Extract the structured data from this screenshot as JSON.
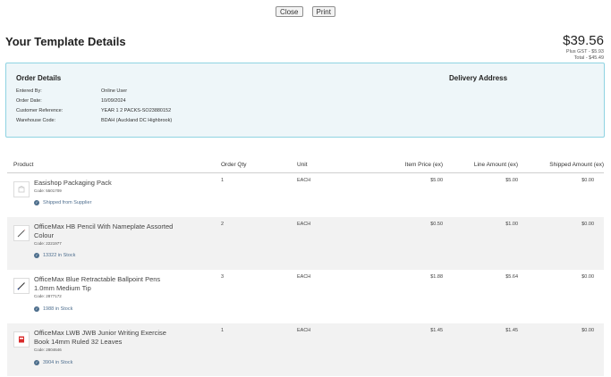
{
  "toolbar": {
    "close_label": "Close",
    "print_label": "Print"
  },
  "page_title": "Your Template Details",
  "totals": {
    "amount": "$39.56",
    "gst": "Plus GST - $5.93",
    "total": "Total - $45.49"
  },
  "order_details": {
    "heading": "Order Details",
    "delivery_heading": "Delivery Address",
    "fields": [
      {
        "label": "Entered By:",
        "value": "Online User"
      },
      {
        "label": "Order Date:",
        "value": "10/09/2024"
      },
      {
        "label": "Customer Reference:",
        "value": "YEAR 1 2 PACKS-SO23880152"
      },
      {
        "label": "Warehouse Code:",
        "value": "BDAH (Auckland DC Highbrook)"
      }
    ]
  },
  "table": {
    "headers": {
      "product": "Product",
      "qty": "Order Qty",
      "unit": "Unit",
      "price": "Item Price (ex)",
      "line": "Line Amount (ex)",
      "shipped": "Shipped Amount (ex)"
    },
    "items": [
      {
        "name": "Easishop Packaging Pack",
        "code": "Code: 5501709",
        "stock": "Shipped from Supplier",
        "qty": "1",
        "unit": "EACH",
        "price": "$5.00",
        "line": "$5.00",
        "shipped": "$0.00",
        "icon": "box-icon"
      },
      {
        "name": "OfficeMax HB Pencil With Nameplate Assorted Colour",
        "code": "Code: 2221977",
        "stock": "13322 in Stock",
        "qty": "2",
        "unit": "EACH",
        "price": "$0.50",
        "line": "$1.00",
        "shipped": "$0.00",
        "icon": "pencil-icon"
      },
      {
        "name": "OfficeMax Blue Retractable Ballpoint Pens 1.0mm Medium Tip",
        "code": "Code: 2877172",
        "stock": "1988 in Stock",
        "qty": "3",
        "unit": "EACH",
        "price": "$1.88",
        "line": "$5.64",
        "shipped": "$0.00",
        "icon": "pen-icon"
      },
      {
        "name": "OfficeMax LWB JWB Junior Writing Exercise Book 14mm Ruled 32 Leaves",
        "code": "Code: 2804646",
        "stock": "3904 in Stock",
        "qty": "1",
        "unit": "EACH",
        "price": "$1.45",
        "line": "$1.45",
        "shipped": "$0.00",
        "icon": "exercise-book-icon"
      }
    ]
  },
  "colors": {
    "accent_border": "#8fd3e2",
    "details_bg": "#eef6f9",
    "stock_text": "#4f6f8f",
    "row_alt": "#f2f2f2"
  }
}
